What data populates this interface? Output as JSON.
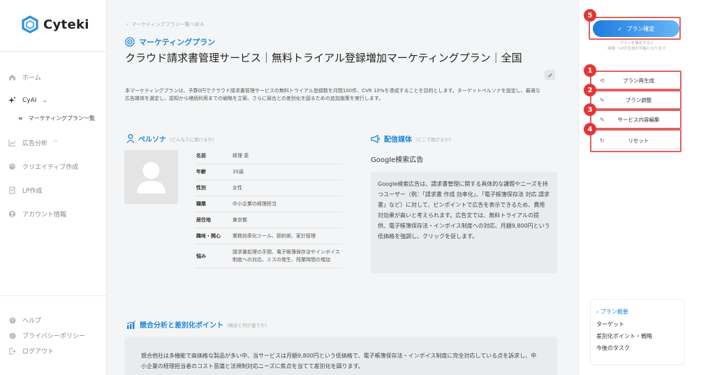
{
  "app": {
    "name": "Cyteki",
    "brand_color": "#1e87d8"
  },
  "sidebar": {
    "items": [
      {
        "label": "ホーム",
        "icon": "home-icon"
      },
      {
        "label": "CyAI",
        "icon": "sparkle-icon",
        "expanded": true
      },
      {
        "label": "マーケティングプラン一覧",
        "icon": "list-icon"
      },
      {
        "label": "広告分析",
        "icon": "chart-icon"
      },
      {
        "label": "クリエイティブ作成",
        "icon": "palette-icon"
      },
      {
        "label": "LP作成",
        "icon": "document-icon"
      },
      {
        "label": "アカウント情報",
        "icon": "user-circle-icon"
      }
    ],
    "footer": [
      {
        "label": "ヘルプ",
        "icon": "help-icon"
      },
      {
        "label": "プライバシーポリシー",
        "icon": "info-icon"
      },
      {
        "label": "ログアウト",
        "icon": "logout-icon"
      }
    ]
  },
  "main": {
    "breadcrumb": "マーケティングプラン一覧へ戻る",
    "category": "マーケティングプラン",
    "title": "クラウド請求書管理サービス｜無料トライアル登録増加マーケティングプラン｜全国",
    "description": "本マーケティングプランは、予算0円でクラウド請求書管理サービスの無料トライアル登録数を月間100件、CVR 10%を達成することを目的とします。ターゲットペルソナを設定し、最適な広告媒体を選定し、認知から継続利用までの戦略を立案、さらに競合との差別化を図るための追加施策を実行します。",
    "persona": {
      "heading": "ペルソナ",
      "subheading": "(どんな人に届けるか)",
      "rows": [
        {
          "key": "名前",
          "value": "経理 恵"
        },
        {
          "key": "年齢",
          "value": "35歳"
        },
        {
          "key": "性別",
          "value": "女性"
        },
        {
          "key": "職業",
          "value": "中小企業の経理担当"
        },
        {
          "key": "居住地",
          "value": "東京都"
        },
        {
          "key": "趣味・関心",
          "value": "業務効率化ツール、節約術、家計管理"
        },
        {
          "key": "悩み",
          "value": "請求書処理の手間、電子帳簿保存法やインボイス制度への対応、ミスの発生、残業時間の増加"
        }
      ]
    },
    "media": {
      "heading": "配信媒体",
      "subheading": "(どこで届けるか)",
      "name": "Google検索広告",
      "body": "Google検索広告は、請求書管理に関する具体的な課題やニーズを持つユーザー（例：「請求書 作成 効率化」、「電子帳簿保存法 対応 請求書」など）に対して、ピンポイントで広告を表示できるため、費用対効果が高いと考えられます。広告文では、無料トライアルの提供、電子帳簿保存法・インボイス制度への対応、月額9,800円という低価格を強調し、クリックを促します。"
    },
    "competition": {
      "heading": "競合分析と差別化ポイント",
      "subheading": "(競合と何が違うか)",
      "body": "競合他社は多機能で高価格な製品が多い中、当サービスは月額9,800円という低価格で、電子帳簿保存法・インボイス制度に完全対応している点を訴求し、中小企業の経理担当者のコスト意識と法規制対応ニーズに焦点を当てて差別化を図ります。"
    }
  },
  "right_panel": {
    "confirm_label": "プラン確定",
    "confirm_hint": "プランを確定すると\n画像・LPの生成が可能になります",
    "actions": [
      {
        "label": "プラン再生成",
        "icon": "refresh-icon",
        "badge": "1"
      },
      {
        "label": "プラン調整",
        "icon": "edit-icon",
        "badge": "2"
      },
      {
        "label": "サービス内容編集",
        "icon": "edit-icon",
        "badge": "3"
      },
      {
        "label": "リセット",
        "icon": "reset-icon",
        "badge": "4"
      }
    ],
    "confirm_badge": "5",
    "toc": [
      {
        "label": "プラン概要",
        "active": true
      },
      {
        "label": "ターゲット",
        "active": false
      },
      {
        "label": "差別化ポイント・戦略",
        "active": false
      },
      {
        "label": "今後のタスク",
        "active": false
      }
    ]
  }
}
